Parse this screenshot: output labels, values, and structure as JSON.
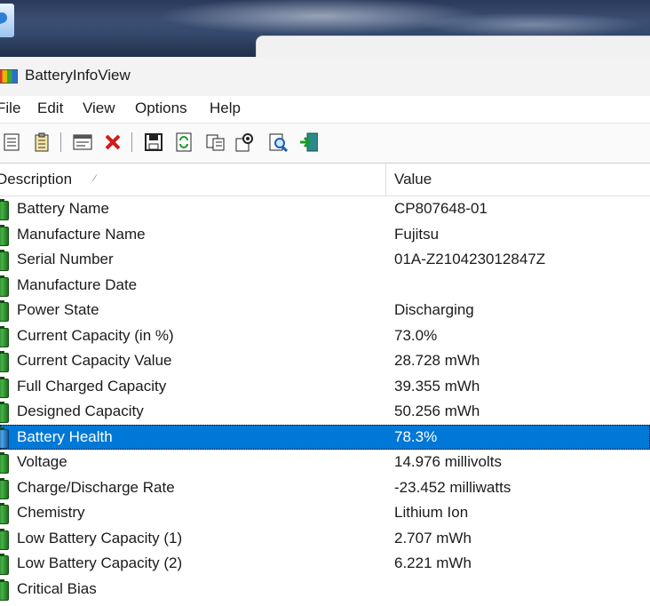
{
  "window": {
    "title": "BatteryInfoView"
  },
  "menu": {
    "items": [
      "File",
      "Edit",
      "View",
      "Options",
      "Help"
    ]
  },
  "toolbar": {
    "buttons": [
      "properties-icon",
      "report-icon",
      "html-report-icon",
      "delete-icon",
      "save-icon",
      "refresh-icon",
      "copy-icon",
      "options-icon",
      "find-icon",
      "exit-icon"
    ]
  },
  "table": {
    "columns": [
      "Description",
      "Value"
    ],
    "rows": [
      {
        "description": "Battery Name",
        "value": "CP807648-01"
      },
      {
        "description": "Manufacture Name",
        "value": "Fujitsu"
      },
      {
        "description": "Serial Number",
        "value": "01A-Z210423012847Z"
      },
      {
        "description": "Manufacture Date",
        "value": ""
      },
      {
        "description": "Power State",
        "value": "Discharging"
      },
      {
        "description": "Current Capacity (in %)",
        "value": "73.0%"
      },
      {
        "description": "Current Capacity Value",
        "value": "28.728 mWh"
      },
      {
        "description": "Full Charged Capacity",
        "value": "39.355 mWh"
      },
      {
        "description": "Designed Capacity",
        "value": "50.256 mWh"
      },
      {
        "description": "Battery Health",
        "value": "78.3%",
        "selected": true
      },
      {
        "description": "Voltage",
        "value": "14.976 millivolts"
      },
      {
        "description": "Charge/Discharge Rate",
        "value": "-23.452 milliwatts"
      },
      {
        "description": "Chemistry",
        "value": "Lithium Ion"
      },
      {
        "description": "Low Battery Capacity (1)",
        "value": "2.707 mWh"
      },
      {
        "description": "Low Battery Capacity (2)",
        "value": "6.221 mWh"
      },
      {
        "description": "Critical Bias",
        "value": ""
      }
    ]
  },
  "colors": {
    "selection": "#0078d7",
    "titlebar": "#f3f3f3"
  }
}
